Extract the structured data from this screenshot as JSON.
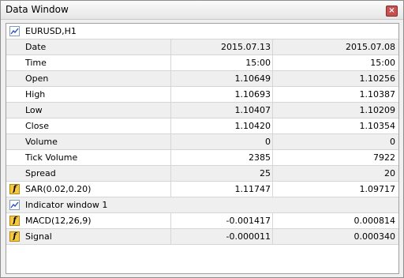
{
  "window": {
    "title": "Data Window",
    "close_glyph": "×"
  },
  "symbol": {
    "label": "EURUSD,H1",
    "icon": "chart-icon"
  },
  "rows": [
    {
      "label": "Date",
      "v1": "2015.07.13",
      "v2": "2015.07.08"
    },
    {
      "label": "Time",
      "v1": "15:00",
      "v2": "15:00"
    },
    {
      "label": "Open",
      "v1": "1.10649",
      "v2": "1.10256"
    },
    {
      "label": "High",
      "v1": "1.10693",
      "v2": "1.10387"
    },
    {
      "label": "Low",
      "v1": "1.10407",
      "v2": "1.10209"
    },
    {
      "label": "Close",
      "v1": "1.10420",
      "v2": "1.10354"
    },
    {
      "label": "Volume",
      "v1": "0",
      "v2": "0"
    },
    {
      "label": "Tick Volume",
      "v1": "2385",
      "v2": "7922"
    },
    {
      "label": "Spread",
      "v1": "25",
      "v2": "20"
    }
  ],
  "sar": {
    "label": "SAR(0.02,0.20)",
    "v1": "1.11747",
    "v2": "1.09717",
    "icon": "function-icon"
  },
  "indicator_window": {
    "label": "Indicator window 1",
    "icon": "chart-icon"
  },
  "macd": {
    "label": "MACD(12,26,9)",
    "v1": "-0.001417",
    "v2": "0.000814",
    "icon": "function-icon"
  },
  "signal": {
    "label": "Signal",
    "v1": "-0.000011",
    "v2": "0.000340",
    "icon": "function-icon"
  },
  "colors": {
    "accent": "#f5c842",
    "alt_row": "#efefef",
    "grid": "#d6d6d6"
  }
}
